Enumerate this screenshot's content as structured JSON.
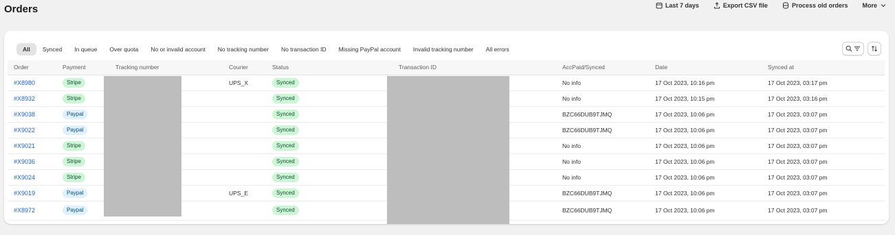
{
  "page": {
    "title": "Orders"
  },
  "actions": [
    {
      "label": "Last 7 days",
      "icon": "calendar-icon"
    },
    {
      "label": "Export CSV file",
      "icon": "export-icon"
    },
    {
      "label": "Process old orders",
      "icon": "database-icon"
    },
    {
      "label": "More",
      "icon": "chevron-down-icon"
    }
  ],
  "tabs": [
    {
      "label": "All",
      "active": true
    },
    {
      "label": "Synced"
    },
    {
      "label": "In queue"
    },
    {
      "label": "Over quota"
    },
    {
      "label": "No or invalid account"
    },
    {
      "label": "No tracking number"
    },
    {
      "label": "No transaction ID"
    },
    {
      "label": "Missing PayPal account"
    },
    {
      "label": "Invalid tracking number"
    },
    {
      "label": "All errors"
    }
  ],
  "tools": {
    "search_filter_icon": "search-filter-icon",
    "sort_icon": "sort-icon"
  },
  "table": {
    "columns": [
      "Order",
      "Payment",
      "Tracking number",
      "Courier",
      "Status",
      "Transaction ID",
      "AccPaid/Synced",
      "Date",
      "Synced at"
    ],
    "rows": [
      {
        "order": "#X8980",
        "payment": "Stripe",
        "tracking": "",
        "courier": "UPS_X",
        "status": "Synced",
        "transaction": "",
        "accpaid": "No info",
        "date": "17 Oct 2023, 10:16 pm",
        "synced_at": "17 Oct 2023, 03:17 pm"
      },
      {
        "order": "#X8932",
        "payment": "Stripe",
        "tracking": "",
        "courier": "",
        "status": "Synced",
        "transaction": "",
        "accpaid": "No info",
        "date": "17 Oct 2023, 10:15 pm",
        "synced_at": "17 Oct 2023, 03:16 pm"
      },
      {
        "order": "#X9038",
        "payment": "Paypal",
        "tracking": "",
        "courier": "",
        "status": "Synced",
        "transaction": "",
        "accpaid": "BZC66DUB9TJMQ",
        "date": "17 Oct 2023, 10:06 pm",
        "synced_at": "17 Oct 2023, 03:07 pm"
      },
      {
        "order": "#X9022",
        "payment": "Paypal",
        "tracking": "",
        "courier": "",
        "status": "Synced",
        "transaction": "",
        "accpaid": "BZC66DUB9TJMQ",
        "date": "17 Oct 2023, 10:06 pm",
        "synced_at": "17 Oct 2023, 03:07 pm"
      },
      {
        "order": "#X9021",
        "payment": "Stripe",
        "tracking": "",
        "courier": "",
        "status": "Synced",
        "transaction": "",
        "accpaid": "No info",
        "date": "17 Oct 2023, 10:06 pm",
        "synced_at": "17 Oct 2023, 03:07 pm"
      },
      {
        "order": "#X9036",
        "payment": "Stripe",
        "tracking": "",
        "courier": "",
        "status": "Synced",
        "transaction": "",
        "accpaid": "No info",
        "date": "17 Oct 2023, 10:06 pm",
        "synced_at": "17 Oct 2023, 03:07 pm"
      },
      {
        "order": "#X9024",
        "payment": "Stripe",
        "tracking": "",
        "courier": "",
        "status": "Synced",
        "transaction": "",
        "accpaid": "No info",
        "date": "17 Oct 2023, 10:06 pm",
        "synced_at": "17 Oct 2023, 03:07 pm"
      },
      {
        "order": "#X9019",
        "payment": "Paypal",
        "tracking": "",
        "courier": "UPS_E",
        "status": "Synced",
        "transaction": "",
        "accpaid": "BZC66DUB9TJMQ",
        "date": "17 Oct 2023, 10:06 pm",
        "synced_at": "17 Oct 2023, 03:07 pm"
      },
      {
        "order": "#X8972",
        "payment": "Paypal",
        "tracking": "",
        "courier": "",
        "status": "Synced",
        "transaction": "",
        "accpaid": "BZC66DUB9TJMQ",
        "date": "17 Oct 2023, 10:06 pm",
        "synced_at": "17 Oct 2023, 03:07 pm"
      }
    ]
  },
  "colors": {
    "link": "#1d63c9",
    "stripe_badge_bg": "#cdf5d6",
    "paypal_badge_bg": "#e0f0ff",
    "status_badge_bg": "#cdf5d6",
    "redaction": "#bdbdbd"
  }
}
